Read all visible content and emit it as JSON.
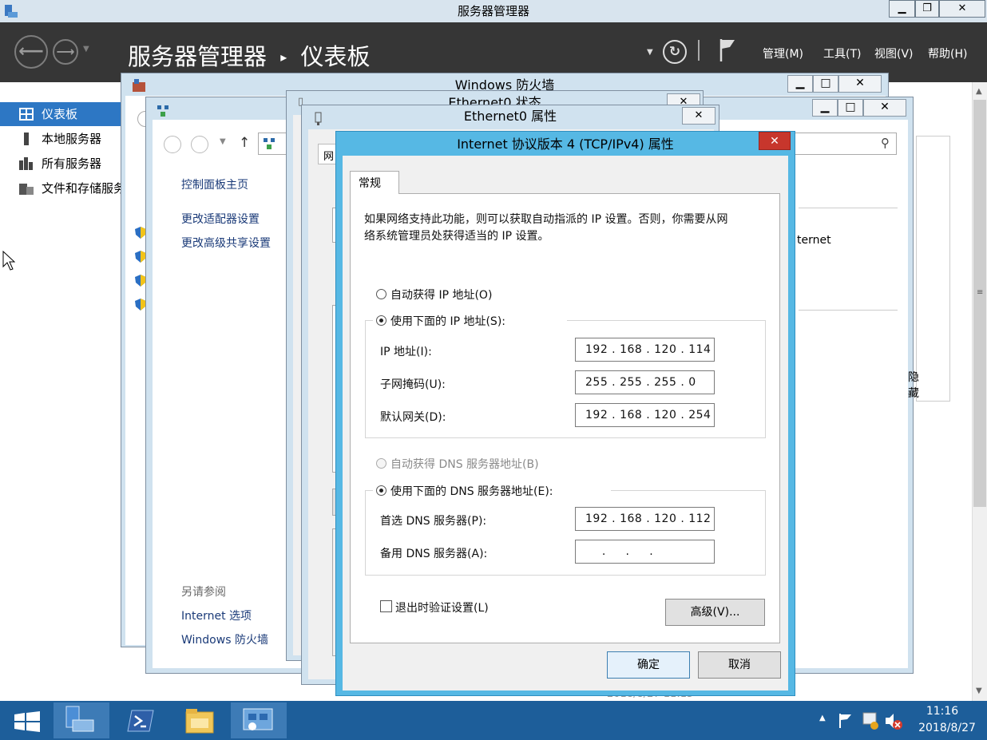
{
  "sm": {
    "title": "服务器管理器",
    "breadcrumb_root": "服务器管理器",
    "breadcrumb_sep": "▸",
    "breadcrumb_page": "仪表板",
    "menus": [
      "管理(M)",
      "工具(T)",
      "视图(V)",
      "帮助(H)"
    ],
    "sidebar": [
      {
        "label": "仪表板",
        "icon": "dashboard-icon"
      },
      {
        "label": "本地服务器",
        "icon": "server-icon"
      },
      {
        "label": "所有服务器",
        "icon": "servers-icon"
      },
      {
        "label": "文件和存储服务",
        "icon": "storage-icon"
      }
    ],
    "right_fragments": {
      "internet": "ternet",
      "hidden": "隐藏"
    }
  },
  "firewall": {
    "title": "Windows 防火墙"
  },
  "network_center": {
    "links": [
      "控制面板主页",
      "更改适配器设置",
      "更改高级共享设置"
    ],
    "see_also": "另请参阅",
    "see_also_links": [
      "Internet 选项",
      "Windows 防火墙"
    ]
  },
  "eth_status": {
    "title": "Ethernet0 状态"
  },
  "eth_props": {
    "title": "Ethernet0 属性",
    "tab_fragment": "网"
  },
  "tcp": {
    "title": "Internet 协议版本 4 (TCP/IPv4) 属性",
    "tab": "常规",
    "desc_line1": "如果网络支持此功能，则可以获取自动指派的 IP 设置。否则，你需要从网",
    "desc_line2": "络系统管理员处获得适当的 IP 设置。",
    "auto_ip": "自动获得 IP 地址(O)",
    "manual_ip": "使用下面的 IP 地址(S):",
    "ip_label": "IP 地址(I):",
    "ip_value": "192 . 168 . 120 . 114",
    "mask_label": "子网掩码(U):",
    "mask_value": "255 . 255 . 255 .  0",
    "gw_label": "默认网关(D):",
    "gw_value": "192 . 168 . 120 . 254",
    "auto_dns": "自动获得 DNS 服务器地址(B)",
    "manual_dns": "使用下面的 DNS 服务器地址(E):",
    "dns1_label": "首选 DNS 服务器(P):",
    "dns1_value": "192 . 168 . 120 . 112",
    "dns2_label": "备用 DNS 服务器(A):",
    "dns2_value": "   .     .     .",
    "validate": "退出时验证设置(L)",
    "advanced": "高级(V)...",
    "ok": "确定",
    "cancel": "取消"
  },
  "bg_timestamp": "2018/8/27 11:15",
  "taskbar": {
    "time": "11:16",
    "date": "2018/8/27"
  },
  "colors": {
    "accent": "#2d77c4",
    "taskbar": "#1d5e9a",
    "dialog_frame": "#56b8e4",
    "close_red": "#c7362c"
  }
}
